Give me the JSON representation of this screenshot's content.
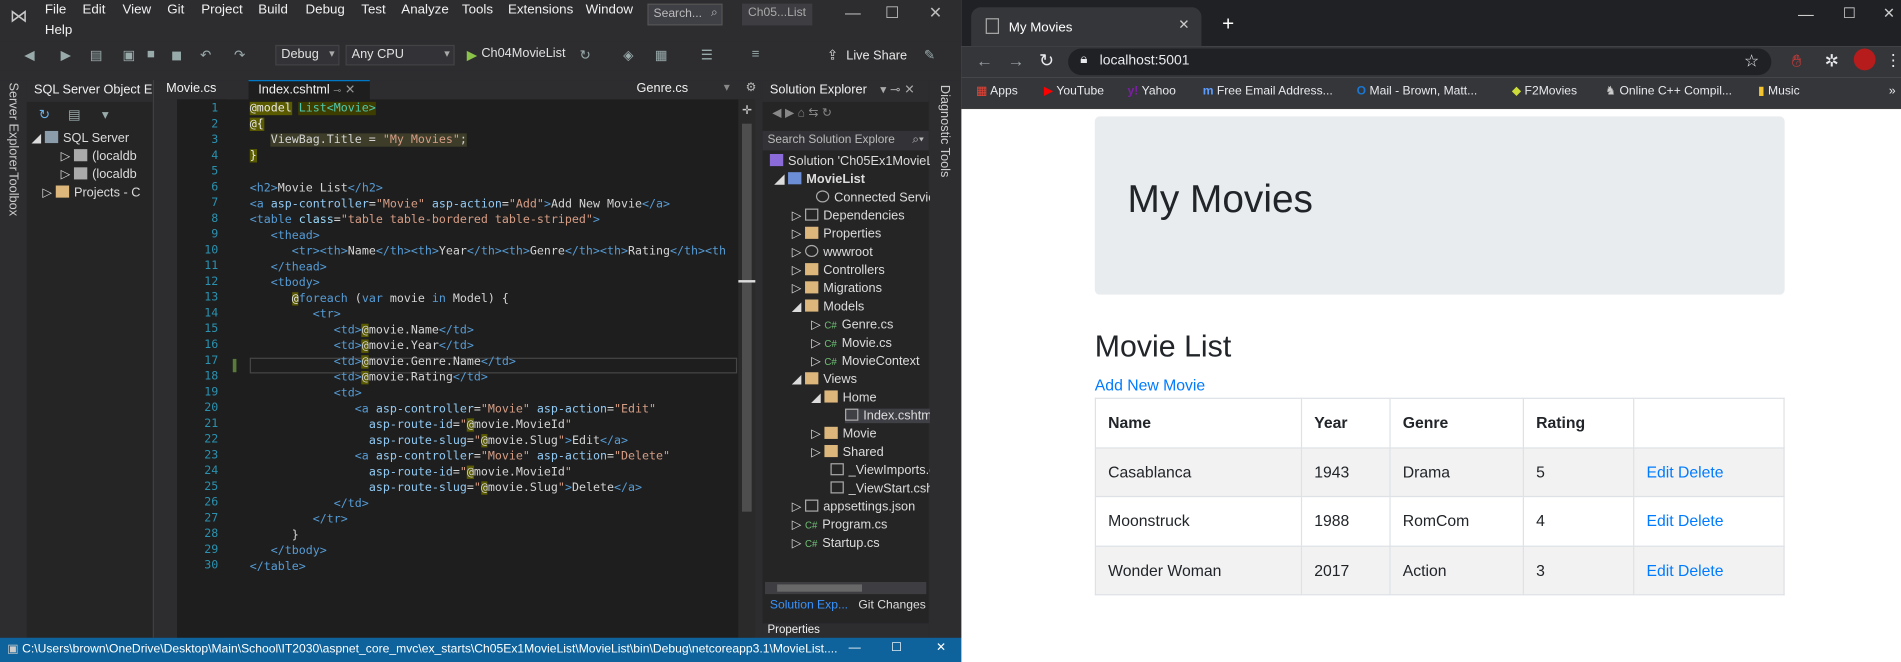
{
  "vs": {
    "menu": [
      "File",
      "Edit",
      "View",
      "Git",
      "Project",
      "Build",
      "Debug",
      "Test",
      "Analyze",
      "Tools",
      "Extensions",
      "Window",
      "Help"
    ],
    "search_placeholder": "Search...",
    "solution_title": "Ch05...List",
    "config": "Debug",
    "platform": "Any CPU",
    "startup": "Ch04MovieList",
    "live_share": "Live Share",
    "left_tabs": [
      "Server Explorer",
      "Toolbox"
    ],
    "sql_panel": {
      "title": "SQL Server Object E...",
      "items": [
        "SQL Server",
        "(localdb",
        "(localdb",
        "Projects - C"
      ]
    },
    "tabs": [
      "Movie.cs",
      "Index.cshtml",
      "Genre.cs"
    ],
    "line_numbers": [
      "1",
      "2",
      "3",
      "4",
      "5",
      "6",
      "7",
      "8",
      "9",
      "10",
      "11",
      "12",
      "13",
      "14",
      "15",
      "16",
      "17",
      "18",
      "19",
      "20",
      "21",
      "22",
      "23",
      "24",
      "25",
      "26",
      "27",
      "28",
      "29",
      "30"
    ],
    "solution_explorer": {
      "title": "Solution Explorer",
      "search": "Search Solution Explore",
      "items": [
        "Solution 'Ch05Ex1MovieL",
        "MovieList",
        "Connected Servic",
        "Dependencies",
        "Properties",
        "wwwroot",
        "Controllers",
        "Migrations",
        "Models",
        "Genre.cs",
        "Movie.cs",
        "MovieContext",
        "Views",
        "Home",
        "Index.cshtml",
        "Movie",
        "Shared",
        "_ViewImports.c",
        "_ViewStart.csh",
        "appsettings.json",
        "Program.cs",
        "Startup.cs"
      ],
      "bottom_tabs": [
        "Solution Exp...",
        "Git Changes"
      ],
      "properties": "Properties"
    },
    "right_tab": "Diagnostic Tools",
    "status_path": "C:\\Users\\brown\\OneDrive\\Desktop\\Main\\School\\IT2030\\aspnet_core_mvc\\ex_starts\\Ch05Ex1MovieList\\MovieList\\bin\\Debug\\netcoreapp3.1\\MovieList...."
  },
  "browser": {
    "tab_title": "My Movies",
    "url": "localhost:5001",
    "bookmarks": [
      "Apps",
      "YouTube",
      "Yahoo",
      "Free Email Address...",
      "Mail - Brown, Matt...",
      "F2Movies",
      "Online C++ Compil...",
      "Music"
    ],
    "jumbotron_title": "My Movies",
    "heading": "Movie List",
    "add_link": "Add New Movie",
    "columns": [
      "Name",
      "Year",
      "Genre",
      "Rating",
      ""
    ],
    "rows": [
      {
        "name": "Casablanca",
        "year": "1943",
        "genre": "Drama",
        "rating": "5",
        "edit": "Edit",
        "delete": "Delete"
      },
      {
        "name": "Moonstruck",
        "year": "1988",
        "genre": "RomCom",
        "rating": "4",
        "edit": "Edit",
        "delete": "Delete"
      },
      {
        "name": "Wonder Woman",
        "year": "2017",
        "genre": "Action",
        "rating": "3",
        "edit": "Edit",
        "delete": "Delete"
      }
    ]
  }
}
